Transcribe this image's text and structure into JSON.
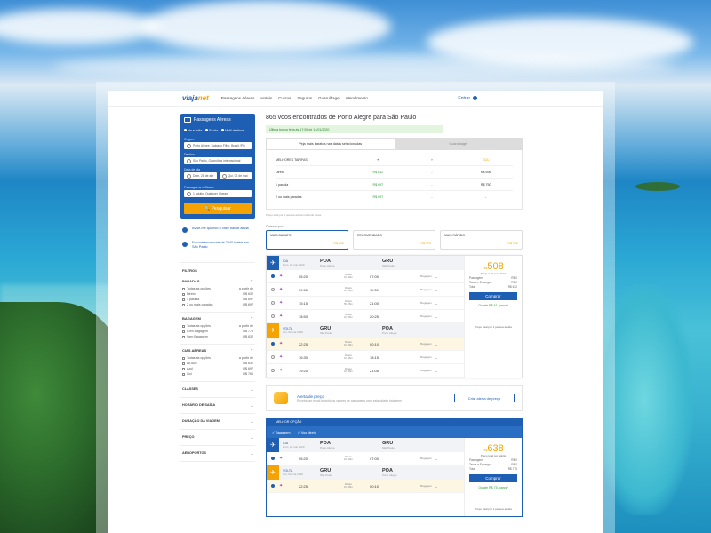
{
  "brand": {
    "logo_main": "viaja",
    "logo_accent": "net",
    "colors": {
      "primary": "#1f5fb3",
      "accent": "#f4a300",
      "green": "#2e9b3a"
    }
  },
  "nav": [
    "Passagens Aéreas",
    "Hotéis",
    "Cursos",
    "Seguros",
    "Guarulhage",
    "Atendimento"
  ],
  "user": {
    "label": "Entrar",
    "icon": "user-icon"
  },
  "search": {
    "title": "Passagens Aéreas",
    "trip_types": [
      "Ida e volta",
      "Só ida",
      "Multi-destinos"
    ],
    "origin_label": "Origem",
    "origin_value": "Porto Alegre, Salgado Filho, Brasil (PO",
    "dest_label": "Destino",
    "dest_value": "São Paulo, Guarulhos internacional",
    "dates_label": "Data de ida",
    "date_out": "Dom, 28 de abr",
    "date_back": "Qui, 02 de mai",
    "pax_label": "Passageiros e Classe",
    "pax_value": "1 adulto, Qualquer Classe",
    "button": "Pesquisar"
  },
  "tips": [
    {
      "text": "Avise-me quando o valor baixar ainda"
    },
    {
      "text": "Encontramos mais de 2040 hotéis em São Paulo"
    }
  ],
  "filters": {
    "head": "FILTROS",
    "sections": [
      {
        "title": "PARADAS",
        "rows": [
          [
            "Todas as opções",
            "a partir de"
          ],
          [
            "Direto",
            "R$ 632"
          ],
          [
            "1 parada",
            "R$ 697"
          ],
          [
            "2 ou mais paradas",
            "R$ 697"
          ]
        ]
      },
      {
        "title": "BAGAGEM",
        "rows": [
          [
            "Todas as opções",
            "a partir de"
          ],
          [
            "Com Bagagem",
            "R$ 775"
          ],
          [
            "Sem Bagagem",
            "R$ 632"
          ]
        ]
      },
      {
        "title": "CIAS AÉREAS",
        "rows": [
          [
            "Todas as opções",
            "a partir de"
          ],
          [
            "LATAM",
            "R$ 632"
          ],
          [
            "Azul",
            "R$ 697"
          ],
          [
            "Gol",
            "R$ 760"
          ]
        ]
      }
    ],
    "collapsed": [
      "CLASSES",
      "HORÁRIO DE SAÍDA",
      "DURAÇÃO DA VIAGEM",
      "PREÇO",
      "AEROPORTOS"
    ]
  },
  "results": {
    "heading": "865 voos encontrados de Porto Alegre para São Paulo",
    "alert": "Última busca feita às 17:59 de 14/01/2020",
    "tab_active": "Veja mais baratos nas datas selecionadas",
    "tab_inactive": "Guarulhage",
    "matrix": {
      "header": [
        "MELHORES TARIFAS",
        "",
        "",
        "GOL"
      ],
      "rows": [
        [
          "Direto",
          "R$ 632",
          "-",
          "R$ 696"
        ],
        [
          "1 parada",
          "R$ 697",
          "-",
          "R$ 750"
        ],
        [
          "2 ou mais paradas",
          "R$ 697",
          "-",
          "-"
        ]
      ],
      "note": "Preço total por 1 pessoa adulta incluindo taxas"
    },
    "sort_label": "Ordenar por:",
    "sort": [
      {
        "label": "MAIS BARATO",
        "price": "R$ 632"
      },
      {
        "label": "RECOMENDADO",
        "price": "R$ 775"
      },
      {
        "label": "MAIS RÁPIDO",
        "price": "R$ 792"
      }
    ]
  },
  "card1": {
    "ida": {
      "label": "IDA",
      "date": "Dom, 28 mai 2020",
      "from": "POA",
      "from_city": "Porto Alegre",
      "to": "GRU",
      "to_city": "São Paulo"
    },
    "ida_rows": [
      [
        "05:20",
        "07:00",
        "Direto",
        "1h 40m"
      ],
      [
        "09:50",
        "11:30",
        "Direto",
        "1h 40m"
      ],
      [
        "15:15",
        "21:00",
        "Direto",
        "5h 45m"
      ],
      [
        "18:50",
        "20:25",
        "Direto",
        "1h 35m"
      ]
    ],
    "volta": {
      "label": "VOLTA",
      "date": "Qui, 02 mai 2020",
      "from": "GRU",
      "from_city": "São Paulo",
      "to": "POA",
      "to_city": "Porto Alegre"
    },
    "volta_rows": [
      [
        "22:25",
        "00:10",
        "Direto",
        "1h 45m"
      ],
      [
        "16:30",
        "18:15",
        "Direto",
        "1h 45m"
      ],
      [
        "19:20",
        "21:05",
        "Direto",
        "1h 45m"
      ]
    ],
    "bag": "Bagagem",
    "price_cur": "R$",
    "price_main": "508",
    "price_sub": "Preço total por adulto",
    "lines": [
      [
        "Passagem",
        "R$ 0"
      ],
      [
        "Taxas e Encargos",
        "R$ 0"
      ],
      [
        "Total",
        "R$ 632"
      ]
    ],
    "button": "Comprar",
    "installments": "Ou até R$ 61 /parcs*",
    "bottom": "Preço total por 1 pessoa adulta"
  },
  "price_alert": {
    "title": "Alerta de preço",
    "sub": "Receba um email quando os valores de passagens para esta cidade baixarem",
    "button": "Criar alerta de preço"
  },
  "card2": {
    "header": "MELHOR OPÇÃO",
    "tags": [
      "Bagagem",
      "Voo direto"
    ],
    "ida": {
      "label": "IDA",
      "date": "Dom, 28 mai 2020",
      "from": "POA",
      "from_city": "Porto Alegre",
      "to": "GRU",
      "to_city": "São Paulo"
    },
    "ida_rows": [
      [
        "05:20",
        "07:00",
        "Direto",
        "1h 40m"
      ]
    ],
    "volta": {
      "label": "VOLTA",
      "date": "Qui, 02 mai 2020",
      "from": "GRU",
      "from_city": "São Paulo",
      "to": "POA",
      "to_city": "Porto Alegre"
    },
    "volta_rows": [
      [
        "22:25",
        "00:10",
        "Direto",
        "1h 45m"
      ]
    ],
    "bag": "Bagagem",
    "price_cur": "R$",
    "price_main": "638",
    "price_sub": "Preço total por adulto",
    "lines": [
      [
        "Passagem",
        "R$ 0"
      ],
      [
        "Taxas e Encargos",
        "R$ 0"
      ],
      [
        "Total",
        "R$ 775"
      ]
    ],
    "button": "Comprar",
    "installments": "Ou até R$ 75 /parcs*",
    "bottom": "Preço total por 1 pessoa adulta"
  }
}
